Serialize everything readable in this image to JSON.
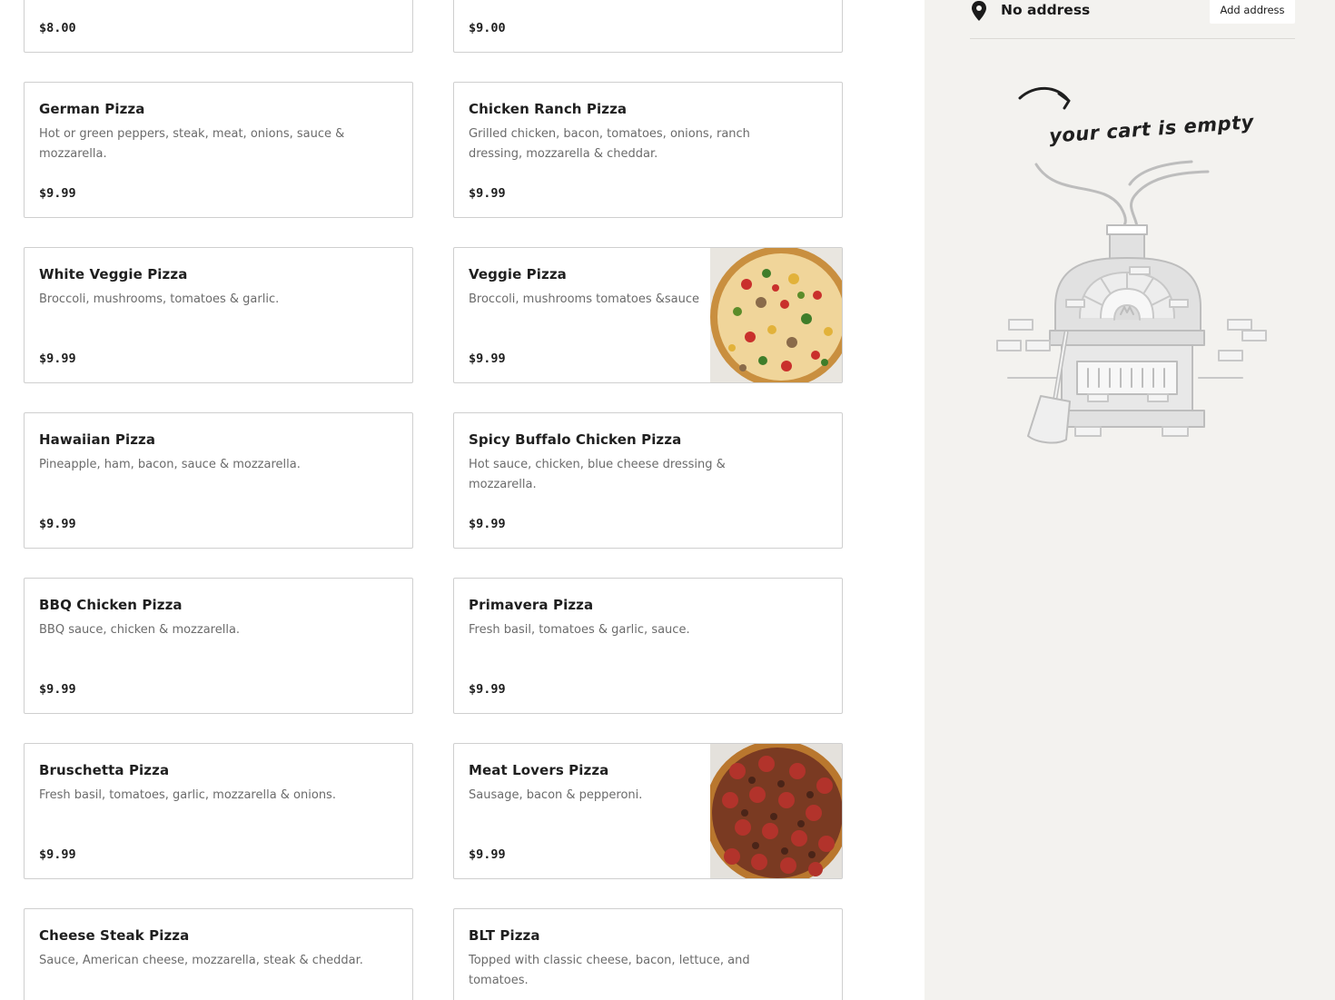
{
  "menu": {
    "top_prices": [
      "$8.00",
      "$9.00"
    ],
    "items": [
      {
        "name": "German Pizza",
        "desc": "Hot or green peppers, steak, meat, onions, sauce & mozzarella.",
        "price": "$9.99"
      },
      {
        "name": "Chicken Ranch Pizza",
        "desc": "Grilled chicken, bacon, tomatoes, onions, ranch dressing, mozzarella & cheddar.",
        "price": "$9.99"
      },
      {
        "name": "White Veggie Pizza",
        "desc": "Broccoli, mushrooms, tomatoes & garlic.",
        "price": "$9.99"
      },
      {
        "name": "Veggie Pizza",
        "desc": "Broccoli, mushrooms tomatoes &sauce",
        "price": "$9.99"
      },
      {
        "name": "Hawaiian Pizza",
        "desc": "Pineapple, ham, bacon, sauce & mozzarella.",
        "price": "$9.99"
      },
      {
        "name": "Spicy Buffalo Chicken Pizza",
        "desc": "Hot sauce, chicken, blue cheese dressing & mozzarella.",
        "price": "$9.99"
      },
      {
        "name": "BBQ Chicken Pizza",
        "desc": "BBQ sauce, chicken & mozzarella.",
        "price": "$9.99"
      },
      {
        "name": "Primavera Pizza",
        "desc": "Fresh basil, tomatoes & garlic, sauce.",
        "price": "$9.99"
      },
      {
        "name": "Bruschetta Pizza",
        "desc": "Fresh basil, tomatoes, garlic, mozzarella & onions.",
        "price": "$9.99"
      },
      {
        "name": "Meat Lovers Pizza",
        "desc": "Sausage, bacon & pepperoni.",
        "price": "$9.99"
      },
      {
        "name": "Cheese Steak Pizza",
        "desc": "Sauce, American cheese, mozzarella, steak & cheddar.",
        "price": ""
      },
      {
        "name": "BLT Pizza",
        "desc": "Topped with classic cheese, bacon, lettuce, and tomatoes.",
        "price": ""
      }
    ]
  },
  "cart": {
    "address_icon": "location-pin-icon",
    "address_text": "No address",
    "add_address_label": "Add address",
    "empty_message": "your cart is empty",
    "illustration": "pizza-oven-illustration"
  },
  "colors": {
    "card_border": "#cfcfcf",
    "muted_text": "#6b6b6b",
    "cart_background": "#f3f2ef"
  }
}
